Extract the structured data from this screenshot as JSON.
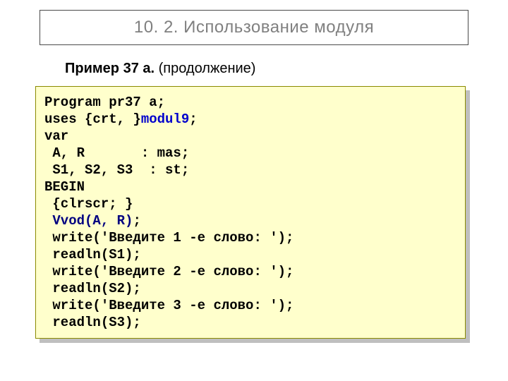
{
  "title": "10. 2. Использование модуля",
  "subtitle_bold": "Пример 37 а.",
  "subtitle_normal": " (продолжение)",
  "code": {
    "l1a": "Program pr37 a;",
    "l2a": "uses {crt, }",
    "l2b": "modul9",
    "l2c": ";",
    "l3": "var",
    "l4": " A, R       : mas;",
    "l5": " S1, S2, S3  : st;",
    "l6": "BEGIN",
    "l7": " {clrscr; }",
    "l8a": " ",
    "l8b": "Vvod(A, R)",
    "l8c": ";",
    "l9": " write('Введите 1 -е слово: ');",
    "l10": " readln(S1);",
    "l11": " write('Введите 2 -е слово: ');",
    "l12": " readln(S2);",
    "l13": " write('Введите 3 -е слово: ');",
    "l14": " readln(S3);"
  }
}
